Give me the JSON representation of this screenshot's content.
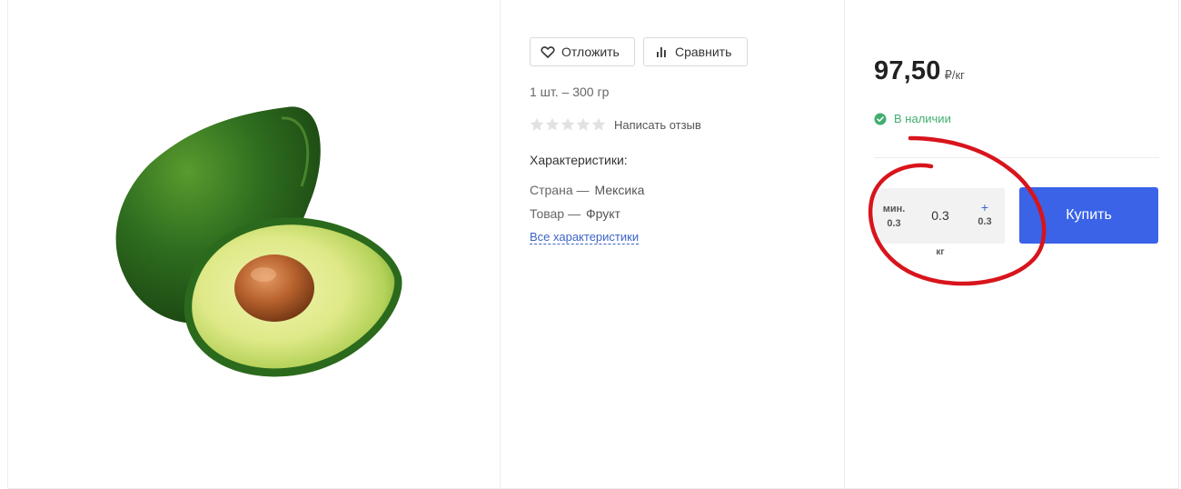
{
  "actions": {
    "save_label": "Отложить",
    "compare_label": "Сравнить"
  },
  "product": {
    "unit_note": "1 шт. – 300 гр",
    "rating_stars": 0,
    "rating_max": 5,
    "review_link": "Написать отзыв"
  },
  "characteristics": {
    "title": "Характеристики:",
    "items": [
      {
        "name": "Страна —",
        "value": "Мексика"
      },
      {
        "name": "Товар —",
        "value": "Фрукт"
      }
    ],
    "all_link": "Все характеристики"
  },
  "pricing": {
    "price": "97,50",
    "unit": "₽/кг",
    "stock": "В наличии"
  },
  "quantity": {
    "min_label": "мин.",
    "min_value": "0.3",
    "value": "0.3",
    "plus_symbol": "+",
    "step": "0.3",
    "unit": "кг"
  },
  "buy_label": "Купить",
  "icons": {
    "save": "heart-icon",
    "compare": "bar-chart-icon",
    "stock": "check-circle-icon",
    "star": "star-icon"
  },
  "colors": {
    "accent": "#3a63e8",
    "link": "#3c63c9",
    "in_stock": "#41ae6e",
    "annotation": "#d8141c"
  }
}
